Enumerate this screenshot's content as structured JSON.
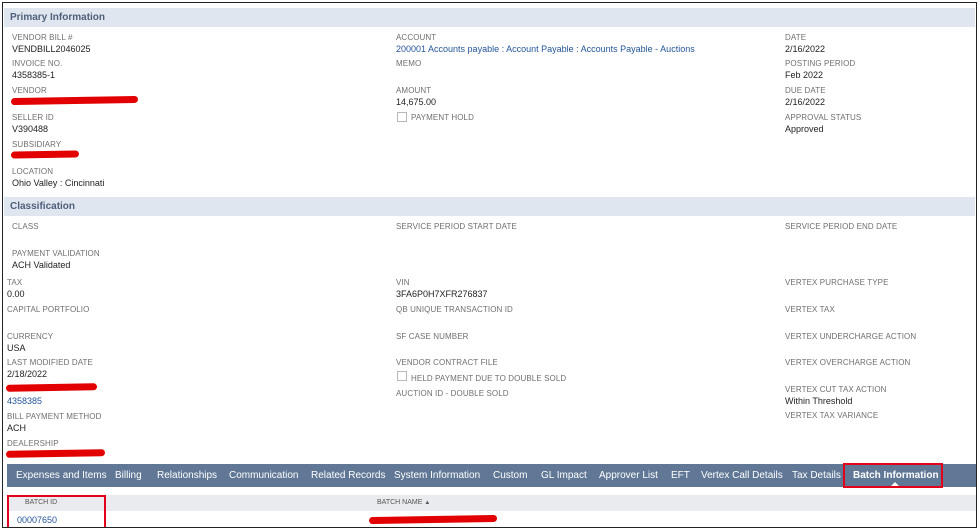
{
  "sections": {
    "primary": "Primary Information",
    "classification": "Classification"
  },
  "primary": {
    "vendor_bill_label": "VENDOR BILL #",
    "vendor_bill_value": "VENDBILL2046025",
    "invoice_label": "INVOICE NO.",
    "invoice_value": "4358385-1",
    "vendor_label": "VENDOR",
    "seller_id_label": "SELLER ID",
    "seller_id_value": "V390488",
    "subsidiary_label": "SUBSIDIARY",
    "location_label": "LOCATION",
    "location_value": "Ohio Valley : Cincinnati",
    "account_label": "ACCOUNT",
    "account_value": "200001 Accounts payable : Account Payable : Accounts Payable - Auctions",
    "memo_label": "MEMO",
    "amount_label": "AMOUNT",
    "amount_value": "14,675.00",
    "payment_hold_label": "PAYMENT HOLD",
    "date_label": "DATE",
    "date_value": "2/16/2022",
    "posting_period_label": "POSTING PERIOD",
    "posting_period_value": "Feb 2022",
    "due_date_label": "DUE DATE",
    "due_date_value": "2/16/2022",
    "approval_status_label": "APPROVAL STATUS",
    "approval_status_value": "Approved"
  },
  "classification": {
    "class_label": "CLASS",
    "payment_validation_label": "PAYMENT VALIDATION",
    "payment_validation_value": "ACH Validated",
    "tax_label": "TAX",
    "tax_value": "0.00",
    "capital_portfolio_label": "CAPITAL PORTFOLIO",
    "currency_label": "CURRENCY",
    "currency_value": "USA",
    "last_modified_label": "LAST MODIFIED DATE",
    "last_modified_value": "2/18/2022",
    "link_value": "4358385",
    "bill_payment_method_label": "BILL PAYMENT METHOD",
    "bill_payment_method_value": "ACH",
    "dealership_label": "DEALERSHIP",
    "service_start_label": "SERVICE PERIOD START DATE",
    "vin_label": "VIN",
    "vin_value": "3FA6P0H7XFR276837",
    "qb_label": "QB UNIQUE TRANSACTION ID",
    "sf_case_label": "SF CASE NUMBER",
    "vendor_contract_label": "VENDOR CONTRACT FILE",
    "held_payment_label": "HELD PAYMENT DUE TO DOUBLE SOLD",
    "auction_id_label": "AUCTION ID - DOUBLE SOLD",
    "service_end_label": "SERVICE PERIOD END DATE",
    "vertex_purchase_label": "VERTEX PURCHASE TYPE",
    "vertex_tax_label": "VERTEX TAX",
    "vertex_under_label": "VERTEX UNDERCHARGE ACTION",
    "vertex_over_label": "VERTEX OVERCHARGE ACTION",
    "vertex_cut_label": "VERTEX CUT TAX ACTION",
    "vertex_cut_value": "Within Threshold",
    "vertex_variance_label": "VERTEX TAX VARIANCE"
  },
  "tabs": {
    "expenses": "Expenses and Items",
    "billing": "Billing",
    "relationships": "Relationships",
    "communication": "Communication",
    "related_records": "Related Records",
    "system_information": "System Information",
    "custom": "Custom",
    "gl_impact": "GL Impact",
    "approver_list": "Approver List",
    "eft": "EFT",
    "vertex_call": "Vertex Call Details",
    "tax_details": "Tax Details",
    "batch_information": "Batch Information"
  },
  "batch_table": {
    "col_batch_id": "BATCH ID",
    "col_batch_name": "BATCH NAME",
    "sort_indicator": "▲",
    "row_batch_id": "00007650"
  },
  "colors": {
    "section_header_bg": "#e0e6ef",
    "tab_bar_bg": "#607896",
    "link": "#255599",
    "highlight_outline": "#e2001a",
    "redaction": "#e20000"
  }
}
